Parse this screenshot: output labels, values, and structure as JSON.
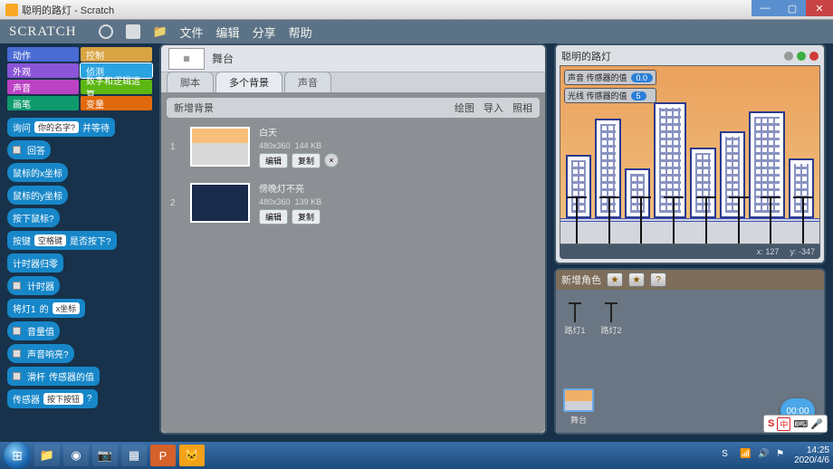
{
  "window": {
    "title": "聪明的路灯 - Scratch"
  },
  "menubar": {
    "logo": "SCRATCH",
    "items": {
      "file": "文件",
      "edit": "编辑",
      "share": "分享",
      "help": "帮助"
    }
  },
  "categories": {
    "motion": "动作",
    "control": "控制",
    "looks": "外观",
    "sensing": "侦测",
    "sound": "声音",
    "operators": "数字和逻辑运算",
    "pen": "画笔",
    "variables": "变量"
  },
  "blocks": {
    "ask_prefix": "询问",
    "ask_q": "你的名字?",
    "ask_suffix": "并等待",
    "answer": "回答",
    "mouse_x": "鼠标的x坐标",
    "mouse_y": "鼠标的y坐标",
    "mouse_down": "按下鼠标?",
    "key_prefix": "按键",
    "key_arg": "空格键",
    "key_suffix": "是否按下?",
    "reset_timer": "计时器归零",
    "timer": "计时器",
    "attr_of_prefix": "将灯1",
    "attr_of_mid": "的",
    "attr_of_arg": "x坐标",
    "loudness": "音量值",
    "loud_q": "声音响亮?",
    "sensor_val_prefix": "滑杆",
    "sensor_val_suffix": "传感器的值",
    "sensor_bool_prefix": "传感器",
    "sensor_bool_arg": "按下按钮",
    "sensor_bool_suffix": "?"
  },
  "center": {
    "sprite_name": "舞台",
    "tabs": {
      "scripts": "脚本",
      "backdrops": "多个背景",
      "sounds": "声音"
    },
    "bg_toolbar": {
      "label": "新增背景",
      "paint": "绘图",
      "import": "导入",
      "camera": "照相"
    },
    "backdrops": [
      {
        "idx": "1",
        "name": "白天",
        "dims": "480x360",
        "size": "144 KB",
        "edit": "编辑",
        "copy": "复制",
        "del": "×"
      },
      {
        "idx": "2",
        "name": "傍晚灯不亮",
        "dims": "480x360",
        "size": "139 KB",
        "edit": "编辑",
        "copy": "复制",
        "del": ""
      }
    ]
  },
  "stage": {
    "title": "聪明的路灯",
    "sensor1_label": "声音 传感器的值",
    "sensor1_val": "0.0",
    "sensor2_label": "光线 传感器的值",
    "sensor2_val": "5",
    "coord_x_label": "x:",
    "coord_x": "127",
    "coord_y_label": "y:",
    "coord_y": "-347"
  },
  "sprite_pane": {
    "label": "新增角色",
    "sprites": [
      {
        "name": "路灯1"
      },
      {
        "name": "路灯2"
      }
    ],
    "stage_label": "舞台"
  },
  "timer_bubble": "00:00",
  "ime": {
    "s": "S",
    "zh": "中"
  },
  "taskbar": {
    "time": "14:25",
    "date": "2020/4/6"
  }
}
